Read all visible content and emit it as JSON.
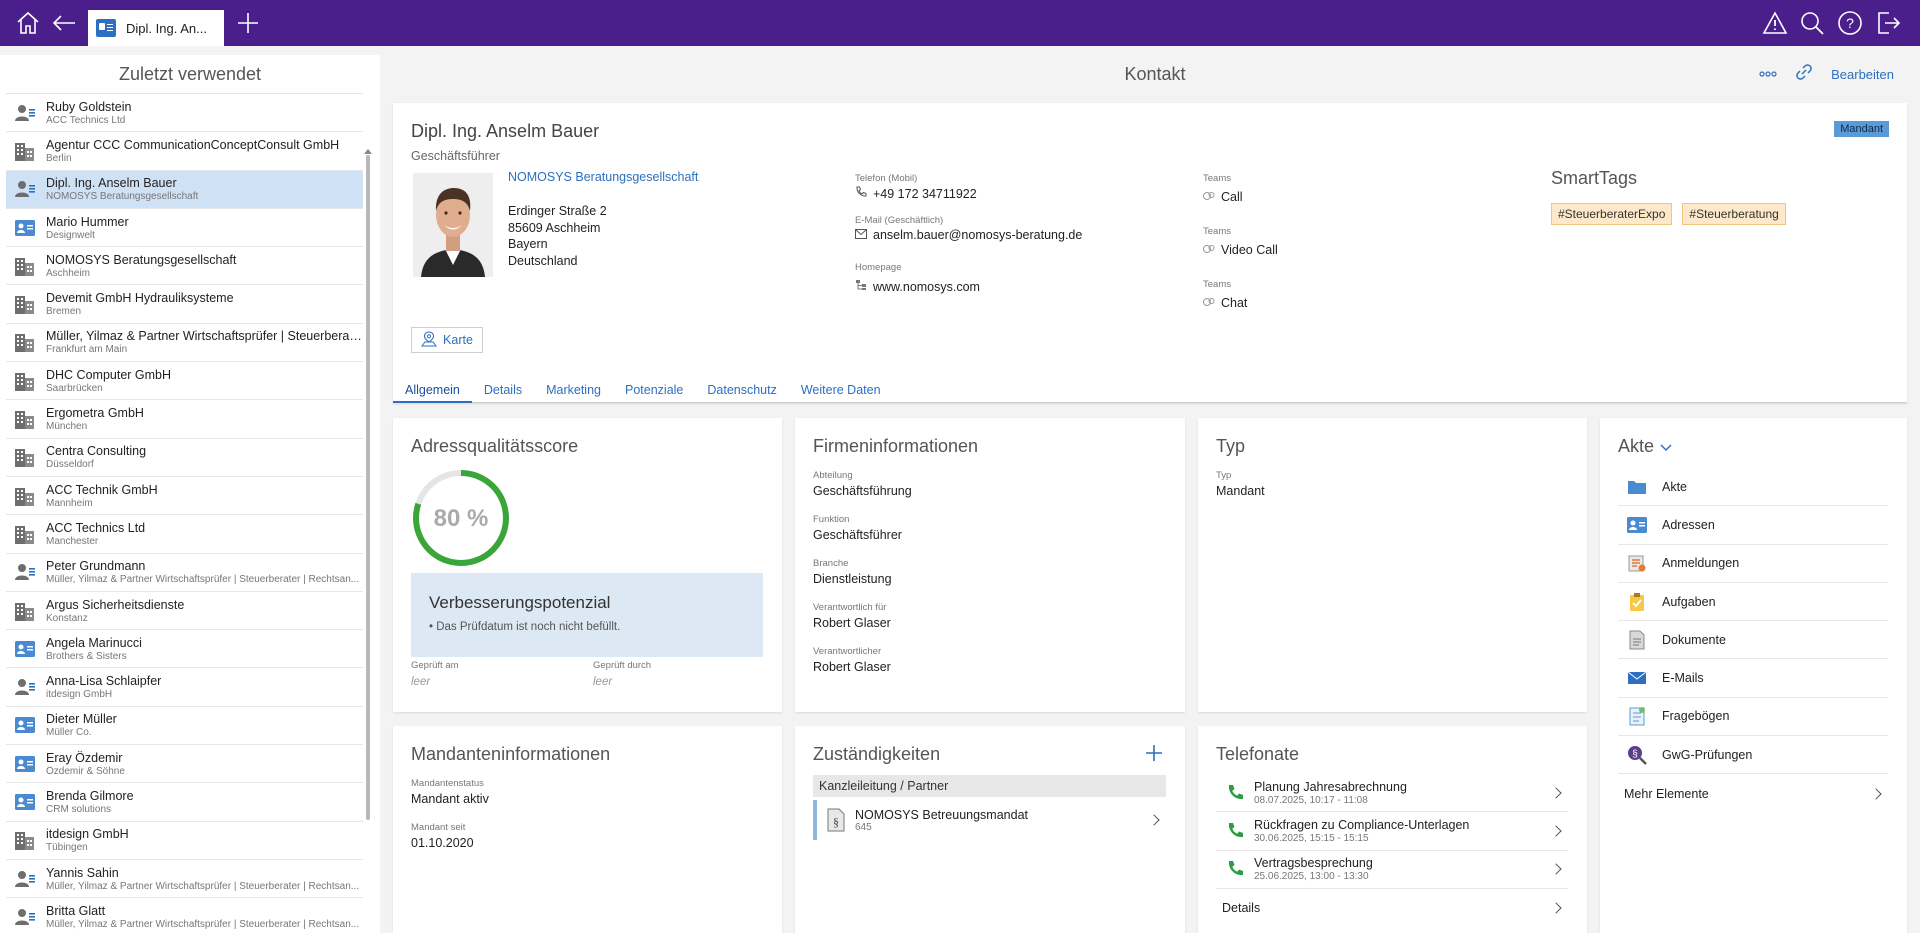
{
  "topbar": {
    "tab_label": "Dipl. Ing. An...",
    "icons": [
      "home-icon",
      "back-icon",
      "plus-icon",
      "warning-icon",
      "search-icon",
      "help-icon",
      "logout-icon"
    ]
  },
  "sidebar": {
    "title": "Zuletzt verwendet",
    "items": [
      {
        "name": "Ruby Goldstein",
        "sub": "ACC Technics Ltd",
        "icon": "person-icon"
      },
      {
        "name": "Agentur CCC CommunicationConceptConsult GmbH",
        "sub": "Berlin",
        "icon": "company-icon"
      },
      {
        "name": "Dipl. Ing. Anselm Bauer",
        "sub": "NOMOSYS Beratungsgesellschaft",
        "icon": "person-icon",
        "active": true
      },
      {
        "name": "Mario Hummer",
        "sub": "Designwelt",
        "icon": "contact-card-icon"
      },
      {
        "name": "NOMOSYS Beratungsgesellschaft",
        "sub": "Aschheim",
        "icon": "company-icon"
      },
      {
        "name": "Devemit GmbH Hydrauliksysteme",
        "sub": "Bremen",
        "icon": "company-icon"
      },
      {
        "name": "Müller, Yilmaz & Partner Wirtschaftsprüfer | Steuerberat...",
        "sub": "Frankfurt am Main",
        "icon": "company-icon"
      },
      {
        "name": "DHC Computer GmbH",
        "sub": "Saarbrücken",
        "icon": "company-icon"
      },
      {
        "name": "Ergometra GmbH",
        "sub": "München",
        "icon": "company-icon"
      },
      {
        "name": "Centra Consulting",
        "sub": "Düsseldorf",
        "icon": "company-icon"
      },
      {
        "name": "ACC Technik GmbH",
        "sub": "Mannheim",
        "icon": "company-icon"
      },
      {
        "name": "ACC Technics Ltd",
        "sub": "Manchester",
        "icon": "company-icon"
      },
      {
        "name": "Peter Grundmann",
        "sub": "Müller, Yilmaz & Partner Wirtschaftsprüfer | Steuerberater | Rechtsan...",
        "icon": "person-icon"
      },
      {
        "name": "Argus Sicherheitsdienste",
        "sub": "Konstanz",
        "icon": "company-icon"
      },
      {
        "name": "Angela Marinucci",
        "sub": "Brothers & Sisters",
        "icon": "contact-card-icon"
      },
      {
        "name": "Anna-Lisa Schlaipfer",
        "sub": "itdesign GmbH",
        "icon": "person-icon"
      },
      {
        "name": "Dieter Müller",
        "sub": "Müller Co.",
        "icon": "contact-card-icon"
      },
      {
        "name": "Eray Özdemir",
        "sub": "Özdemir & Söhne",
        "icon": "contact-card-icon"
      },
      {
        "name": "Brenda Gilmore",
        "sub": "CRM solutions",
        "icon": "contact-card-icon"
      },
      {
        "name": "itdesign GmbH",
        "sub": "Tübingen",
        "icon": "company-icon"
      },
      {
        "name": "Yannis Sahin",
        "sub": "Müller, Yilmaz & Partner Wirtschaftsprüfer | Steuerberater | Rechtsan...",
        "icon": "person-icon"
      },
      {
        "name": "Britta Glatt",
        "sub": "Müller, Yilmaz & Partner Wirtschaftsprüfer | Steuerberater | Rechtsan...",
        "icon": "person-icon"
      }
    ]
  },
  "main": {
    "title": "Kontakt",
    "edit_label": "Bearbeiten",
    "contact": {
      "name": "Dipl. Ing. Anselm Bauer",
      "role": "Geschäftsführer",
      "badge": "Mandant",
      "company": "NOMOSYS Beratungsgesellschaft",
      "street": "Erdinger Straße 2",
      "city": "85609 Aschheim",
      "state": "Bayern",
      "country": "Deutschland",
      "phone_label": "Telefon (Mobil)",
      "phone": "+49 172 34711922",
      "email_label": "E-Mail (Geschäftlich)",
      "email": "anselm.bauer@nomosys-beratung.de",
      "homepage_label": "Homepage",
      "homepage": "www.nomosys.com",
      "teams": [
        {
          "label": "Teams",
          "value": "Call"
        },
        {
          "label": "Teams",
          "value": "Video Call"
        },
        {
          "label": "Teams",
          "value": "Chat"
        }
      ],
      "smarttags_title": "SmartTags",
      "tags": [
        "#SteuerberaterExpo",
        "#Steuerberatung"
      ],
      "map_button": "Karte"
    },
    "tabs": [
      "Allgemein",
      "Details",
      "Marketing",
      "Potenziale",
      "Datenschutz",
      "Weitere Daten"
    ],
    "address_quality": {
      "title": "Adressqualitätsscore",
      "score": 80,
      "score_label": "80 %",
      "improve_title": "Verbesserungspotenzial",
      "improve_text": "• Das Prüfdatum ist noch nicht befüllt.",
      "checked_on_label": "Geprüft am",
      "checked_on": "leer",
      "checked_by_label": "Geprüft durch",
      "checked_by": "leer"
    },
    "company_info": {
      "title": "Firmeninformationen",
      "fields": [
        {
          "label": "Abteilung",
          "value": "Geschäftsführung"
        },
        {
          "label": "Funktion",
          "value": "Geschäftsführer"
        },
        {
          "label": "Branche",
          "value": "Dienstleistung"
        },
        {
          "label": "Verantwortlich für",
          "value": "Robert Glaser"
        },
        {
          "label": "Verantwortlicher",
          "value": "Robert Glaser"
        }
      ]
    },
    "type": {
      "title": "Typ",
      "label": "Typ",
      "value": "Mandant"
    },
    "akte": {
      "title": "Akte",
      "items": [
        "Akte",
        "Adressen",
        "Anmeldungen",
        "Aufgaben",
        "Dokumente",
        "E-Mails",
        "Fragebögen",
        "GwG-Prüfungen"
      ],
      "more": "Mehr Elemente"
    },
    "client_info": {
      "title": "Mandanteninformationen",
      "fields": [
        {
          "label": "Mandantenstatus",
          "value": "Mandant aktiv"
        },
        {
          "label": "Mandant seit",
          "value": "01.10.2020"
        }
      ]
    },
    "responsibilities": {
      "title": "Zuständigkeiten",
      "group": "Kanzleileitung / Partner",
      "item_title": "NOMOSYS Betreuungsmandat",
      "item_sub": "645"
    },
    "calls": {
      "title": "Telefonate",
      "items": [
        {
          "title": "Planung Jahresabrechnung",
          "sub": "08.07.2025, 10:17 - 11:08"
        },
        {
          "title": "Rückfragen zu Compliance-Unterlagen",
          "sub": "30.06.2025, 15:15 - 15:15"
        },
        {
          "title": "Vertragsbesprechung",
          "sub": "25.06.2025, 13:00 - 13:30"
        }
      ],
      "details": "Details"
    }
  },
  "colors": {
    "topbar": "#4a1f8c",
    "accent": "#2d6fc0",
    "score_green": "#3aa63a",
    "tag_bg": "#fde9c9"
  }
}
